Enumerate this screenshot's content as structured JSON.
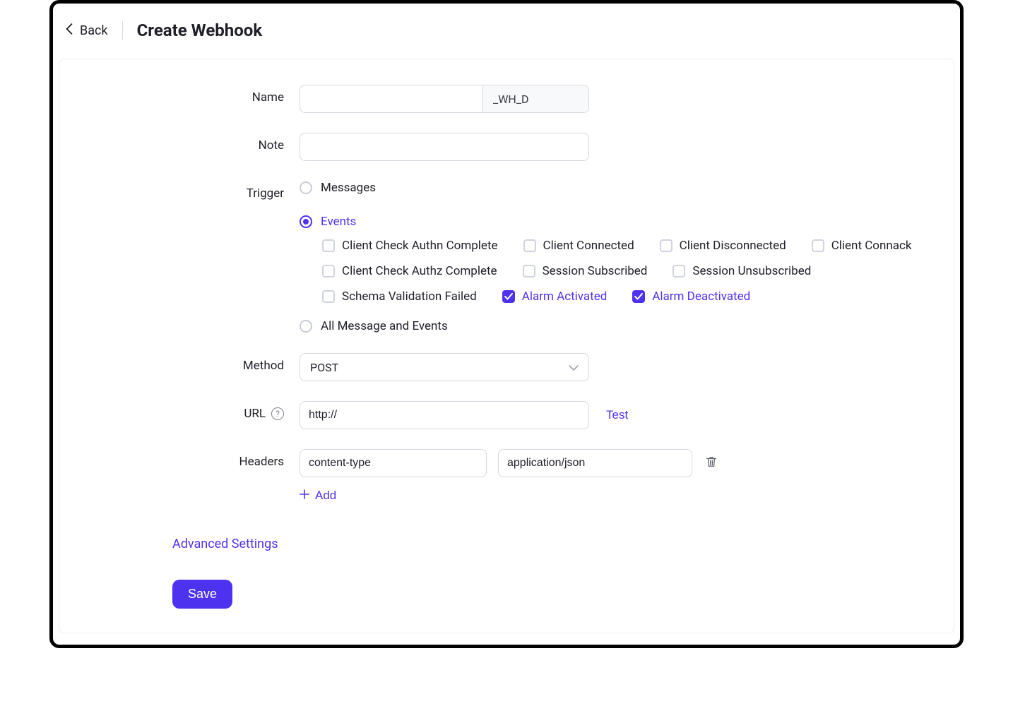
{
  "header": {
    "back_label": "Back",
    "title": "Create Webhook"
  },
  "form": {
    "name_label": "Name",
    "name_value": "",
    "name_suffix": "_WH_D",
    "note_label": "Note",
    "note_value": "",
    "trigger_label": "Trigger",
    "trigger_options": {
      "messages": "Messages",
      "events": "Events",
      "all": "All Message and Events"
    },
    "trigger_selected": "events",
    "events": [
      {
        "label": "Client Check Authn Complete",
        "checked": false
      },
      {
        "label": "Client Connected",
        "checked": false
      },
      {
        "label": "Client Disconnected",
        "checked": false
      },
      {
        "label": "Client Connack",
        "checked": false
      },
      {
        "label": "Client Check Authz Complete",
        "checked": false
      },
      {
        "label": "Session Subscribed",
        "checked": false
      },
      {
        "label": "Session Unsubscribed",
        "checked": false
      },
      {
        "label": "Schema Validation Failed",
        "checked": false
      },
      {
        "label": "Alarm Activated",
        "checked": true
      },
      {
        "label": "Alarm Deactivated",
        "checked": true
      }
    ],
    "method_label": "Method",
    "method_value": "POST",
    "url_label": "URL",
    "url_value": "http://",
    "test_label": "Test",
    "headers_label": "Headers",
    "headers": [
      {
        "key": "content-type",
        "value": "application/json"
      }
    ],
    "add_label": "Add",
    "advanced_label": "Advanced Settings",
    "save_label": "Save"
  }
}
